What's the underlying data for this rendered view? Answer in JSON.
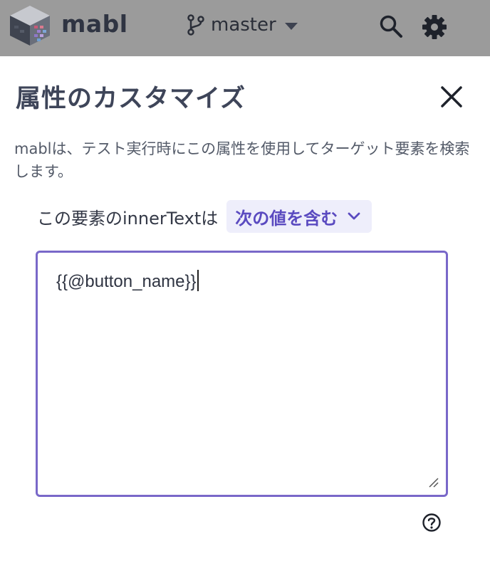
{
  "app": {
    "logo_text": "mabl"
  },
  "header": {
    "branch_label": "master",
    "icons": {
      "branch": "git-branch-icon",
      "dropdown": "caret-down-icon",
      "search": "search-icon",
      "settings": "gear-icon"
    },
    "dimmed": true
  },
  "dialog": {
    "title": "属性のカスタマイズ",
    "close_icon": "close-icon",
    "description": "mablは、テスト実行時にこの属性を使用してターゲット要素を検索します。",
    "condition_label": "この要素のinnerTextは",
    "operator_selected": "次の値を含む",
    "value": "{{@button_name}}",
    "help_icon": "help-circle-icon"
  },
  "colors": {
    "accent": "#7968c9",
    "operator_text": "#5a4ac0",
    "operator_bg": "#eeeefb",
    "title": "#3e4559",
    "header_overlay": "#9b9b9b"
  }
}
